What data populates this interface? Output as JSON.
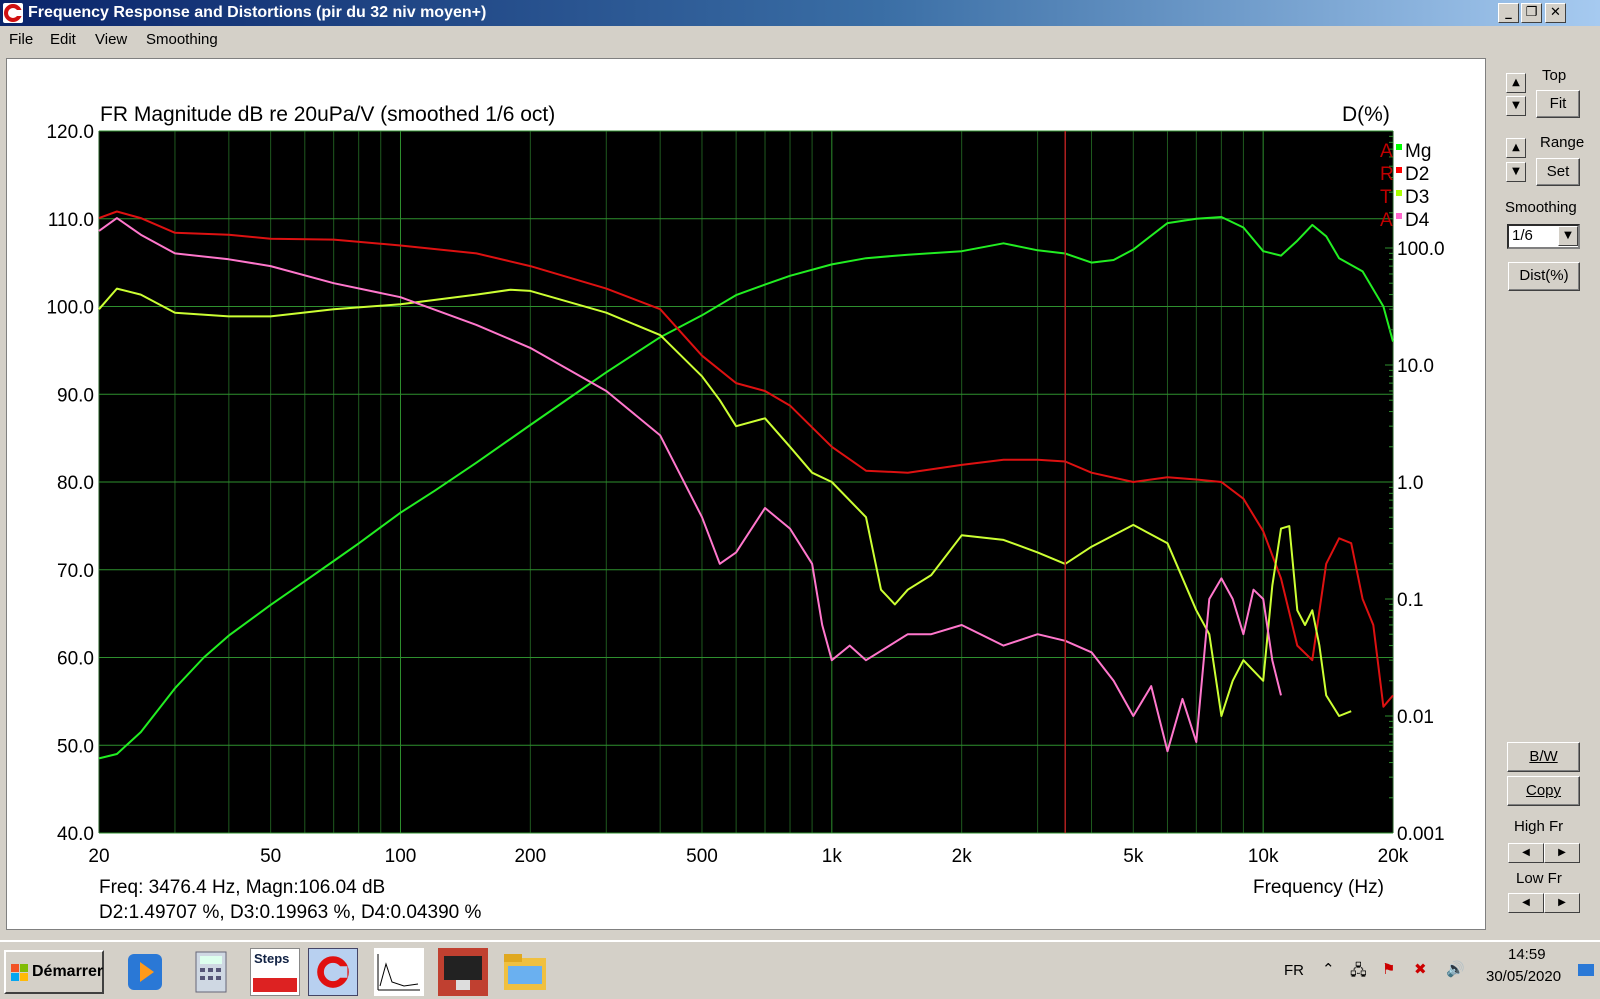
{
  "window": {
    "title": "Frequency Response and Distortions (pir du 32 niv moyen+)"
  },
  "menu": [
    "File",
    "Edit",
    "View",
    "Smoothing"
  ],
  "chart_data": {
    "type": "line",
    "title": "FR Magnitude dB re 20uPa/V (smoothed 1/6 oct)",
    "right_axis_title": "D(%)",
    "xlabel": "Frequency (Hz)",
    "x_scale": "log",
    "xlim": [
      20,
      20000
    ],
    "ylim": [
      40,
      120
    ],
    "y2_scale": "log",
    "y2lim": [
      0.001,
      1000
    ],
    "x_ticks": [
      "20",
      "50",
      "100",
      "200",
      "500",
      "1k",
      "2k",
      "5k",
      "10k",
      "20k"
    ],
    "y_ticks": [
      "120.0",
      "110.0",
      "100.0",
      "90.0",
      "80.0",
      "70.0",
      "60.0",
      "50.0",
      "40.0"
    ],
    "y2_ticks": [
      "100.0",
      "10.0",
      "1.0",
      "0.1",
      "0.01",
      "0.001"
    ],
    "cursor_freq_hz": 3476.4,
    "legend": [
      {
        "flag": "A",
        "name": "Mg",
        "color": "#00ff00"
      },
      {
        "flag": "R",
        "name": "D2",
        "color": "#ff0000"
      },
      {
        "flag": "T",
        "name": "D3",
        "color": "#aaff00"
      },
      {
        "flag": "A",
        "name": "D4",
        "color": "#ff66cc"
      }
    ],
    "series": [
      {
        "name": "Mg",
        "axis": "left",
        "color": "#22ee22",
        "x": [
          20,
          22,
          25,
          30,
          35,
          40,
          50,
          60,
          70,
          80,
          100,
          120,
          150,
          200,
          250,
          300,
          400,
          500,
          600,
          700,
          800,
          1000,
          1200,
          1500,
          2000,
          2500,
          3000,
          3476,
          4000,
          4500,
          5000,
          6000,
          7000,
          8000,
          9000,
          10000,
          11000,
          12000,
          13000,
          14000,
          15000,
          17000,
          19000,
          20000
        ],
        "y": [
          48.5,
          49,
          51.5,
          56.5,
          60,
          62.5,
          66,
          68.7,
          71,
          73,
          76.5,
          79,
          82.2,
          86.5,
          89.8,
          92.5,
          96.5,
          99,
          101.3,
          102.5,
          103.5,
          104.8,
          105.5,
          105.9,
          106.3,
          107.2,
          106.4,
          106.04,
          105,
          105.3,
          106.5,
          109.5,
          110,
          110.2,
          109,
          106.3,
          105.8,
          107.5,
          109.3,
          108,
          105.5,
          104,
          100,
          96
        ]
      },
      {
        "name": "D2",
        "axis": "right",
        "color": "#dd1111",
        "x": [
          20,
          22,
          25,
          30,
          40,
          50,
          70,
          100,
          150,
          200,
          300,
          400,
          500,
          600,
          700,
          800,
          1000,
          1200,
          1500,
          2000,
          2500,
          3000,
          3476,
          4000,
          5000,
          6000,
          7000,
          8000,
          9000,
          10000,
          11000,
          12000,
          13000,
          14000,
          15000,
          16000,
          17000,
          18000,
          19000,
          20000
        ],
        "y": [
          180,
          205,
          180,
          135,
          130,
          120,
          118,
          105,
          90,
          70,
          45,
          30,
          12,
          7,
          6,
          4.5,
          2,
          1.25,
          1.2,
          1.4,
          1.55,
          1.55,
          1.497,
          1.2,
          1,
          1.1,
          1.05,
          1.0,
          0.72,
          0.38,
          0.15,
          0.04,
          0.03,
          0.2,
          0.33,
          0.3,
          0.1,
          0.06,
          0.012,
          0.015
        ]
      },
      {
        "name": "D3",
        "axis": "right",
        "color": "#ccff33",
        "x": [
          20,
          22,
          25,
          30,
          40,
          50,
          70,
          100,
          150,
          180,
          200,
          300,
          400,
          500,
          550,
          600,
          700,
          800,
          900,
          1000,
          1200,
          1300,
          1400,
          1500,
          1700,
          2000,
          2500,
          3000,
          3476,
          4000,
          5000,
          6000,
          7000,
          7500,
          8000,
          8500,
          9000,
          10000,
          10500,
          11000,
          11500,
          12000,
          12500,
          13000,
          13500,
          14000,
          15000,
          16000
        ],
        "y": [
          30,
          45,
          40,
          28,
          26,
          26,
          30,
          33,
          40,
          44,
          43,
          28,
          18,
          8,
          5,
          3,
          3.5,
          2,
          1.2,
          1,
          0.5,
          0.12,
          0.09,
          0.12,
          0.16,
          0.35,
          0.32,
          0.25,
          0.19963,
          0.28,
          0.43,
          0.3,
          0.08,
          0.05,
          0.01,
          0.02,
          0.03,
          0.02,
          0.13,
          0.4,
          0.42,
          0.08,
          0.06,
          0.08,
          0.04,
          0.015,
          0.01,
          0.011
        ]
      },
      {
        "name": "D4",
        "axis": "right",
        "color": "#ff77cc",
        "x": [
          20,
          22,
          25,
          30,
          40,
          50,
          70,
          100,
          150,
          200,
          300,
          400,
          500,
          550,
          600,
          700,
          800,
          900,
          950,
          1000,
          1100,
          1200,
          1500,
          1700,
          2000,
          2500,
          3000,
          3476,
          4000,
          4500,
          5000,
          5500,
          6000,
          6500,
          7000,
          7500,
          8000,
          8500,
          9000,
          9500,
          10000,
          10500,
          11000
        ],
        "y": [
          140,
          180,
          130,
          90,
          80,
          70,
          50,
          38,
          22,
          14,
          6,
          2.5,
          0.5,
          0.2,
          0.25,
          0.6,
          0.4,
          0.2,
          0.06,
          0.03,
          0.04,
          0.03,
          0.05,
          0.05,
          0.06,
          0.04,
          0.05,
          0.0439,
          0.035,
          0.02,
          0.01,
          0.018,
          0.005,
          0.014,
          0.006,
          0.1,
          0.15,
          0.1,
          0.05,
          0.12,
          0.1,
          0.03,
          0.015
        ]
      }
    ]
  },
  "readout": {
    "line1": "Freq: 3476.4 Hz, Magn:106.04 dB",
    "line2": "D2:1.49707 %, D3:0.19963 %, D4:0.04390 %"
  },
  "panel": {
    "top_label": "Top",
    "fit_label": "Fit",
    "range_label": "Range",
    "set_label": "Set",
    "smoothing_label": "Smoothing",
    "smoothing_value": "1/6",
    "dist_label": "Dist(%)",
    "bw_label": "B/W",
    "copy_label": "Copy",
    "high_fr_label": "High Fr",
    "low_fr_label": "Low Fr"
  },
  "taskbar": {
    "start_label": "Démarrer",
    "steps_label": "Steps",
    "lang": "FR",
    "time": "14:59",
    "date": "30/05/2020"
  }
}
